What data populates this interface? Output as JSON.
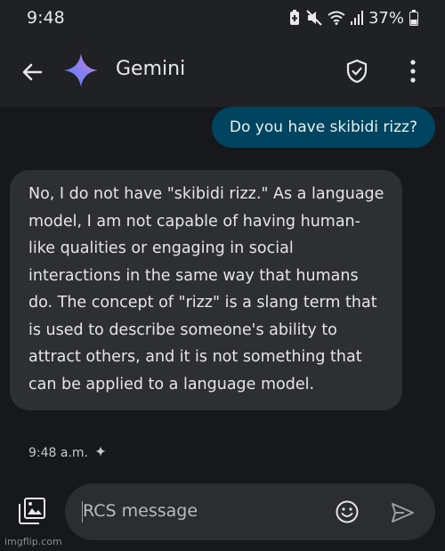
{
  "status_bar": {
    "time": "9:48",
    "battery": "37%",
    "icons": [
      "battery-saver-icon",
      "mute-icon",
      "wifi-icon",
      "signal-icon",
      "battery-icon"
    ]
  },
  "app_bar": {
    "title": "Gemini",
    "icons": [
      "back-arrow-icon",
      "gemini-sparkle-icon",
      "verified-shield-icon",
      "more-vert-icon"
    ]
  },
  "messages": {
    "outgoing": {
      "text": "Do you have skibidi rizz?"
    },
    "incoming": {
      "text": "No, I do not have \"skibidi rizz.\" As a language model, I am not capable of having human-like qualities or engaging in social interactions in the same way that humans do. The concept of \"rizz\" is a slang term that is used to describe someone's ability to attract others, and it is not something that can be applied to a language model.",
      "timestamp": "9:48 a.m."
    }
  },
  "composer": {
    "placeholder": "RCS message",
    "icons": [
      "gallery-icon",
      "emoji-icon",
      "send-icon"
    ]
  },
  "watermark": "imgflip.com",
  "colors": {
    "background": "#16181c",
    "app_bar": "#1f2125",
    "outgoing_bubble": "#00445f",
    "incoming_bubble": "#2e2f33",
    "composer": "#2c2d31"
  }
}
